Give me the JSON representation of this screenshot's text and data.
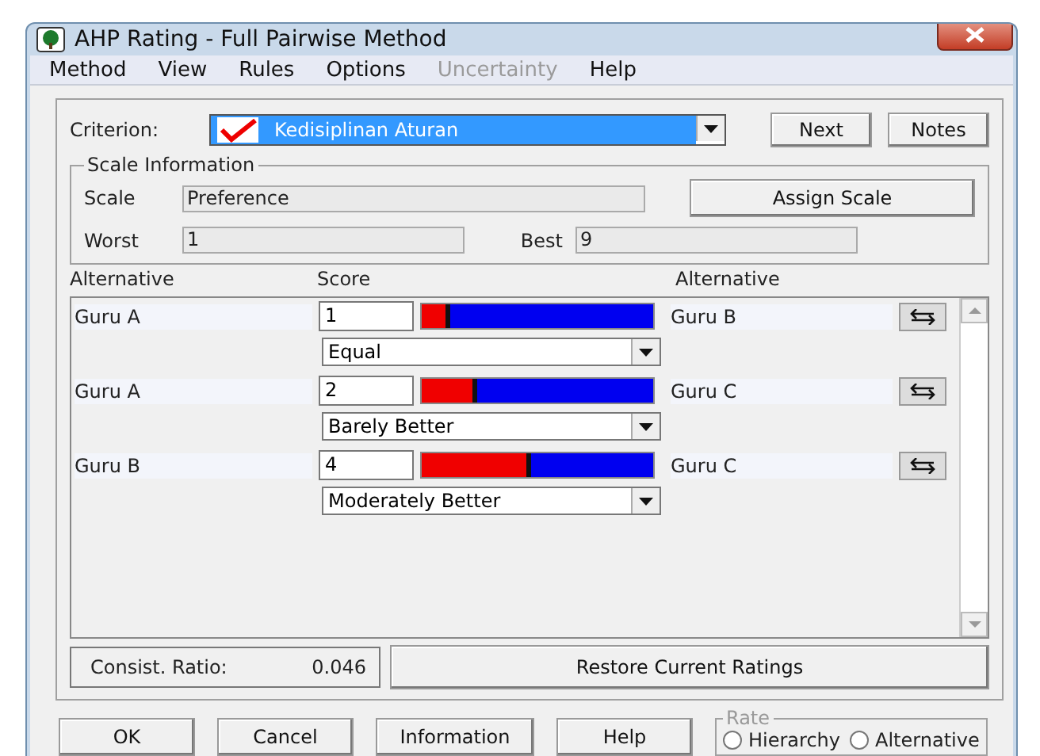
{
  "window": {
    "title": "AHP Rating - Full Pairwise Method"
  },
  "menu": [
    {
      "label": "Method",
      "disabled": false
    },
    {
      "label": "View",
      "disabled": false
    },
    {
      "label": "Rules",
      "disabled": false
    },
    {
      "label": "Options",
      "disabled": false
    },
    {
      "label": "Uncertainty",
      "disabled": true
    },
    {
      "label": "Help",
      "disabled": false
    }
  ],
  "criterion": {
    "label": "Criterion:",
    "value": "Kedisiplinan Aturan",
    "checked": true
  },
  "top_buttons": [
    "Next",
    "Notes"
  ],
  "scale_info": {
    "title": "Scale Information",
    "scale_label": "Scale",
    "scale_value": "Preference",
    "assign_button": "Assign Scale",
    "worst_label": "Worst",
    "worst_value": "1",
    "best_label": "Best",
    "best_value": "9"
  },
  "headers": [
    "Alternative",
    "Score",
    "Alternative"
  ],
  "comparisons": [
    {
      "left": "Guru A",
      "score": "1",
      "level": 0.12,
      "verbal": "Equal",
      "right": "Guru B"
    },
    {
      "left": "Guru A",
      "score": "2",
      "level": 0.24,
      "verbal": "Barely Better",
      "right": "Guru C"
    },
    {
      "left": "Guru B",
      "score": "4",
      "level": 0.47,
      "verbal": "Moderately Better",
      "right": "Guru C"
    }
  ],
  "consistency": {
    "label": "Consist. Ratio:",
    "value": "0.046"
  },
  "restore_button": "Restore Current Ratings",
  "bottom_buttons": [
    "OK",
    "Cancel",
    "Information",
    "Help"
  ],
  "rate": {
    "title": "Rate",
    "options": [
      {
        "label": "Hierarchy",
        "selected": false
      },
      {
        "label": "Alternative",
        "selected": false
      }
    ]
  }
}
